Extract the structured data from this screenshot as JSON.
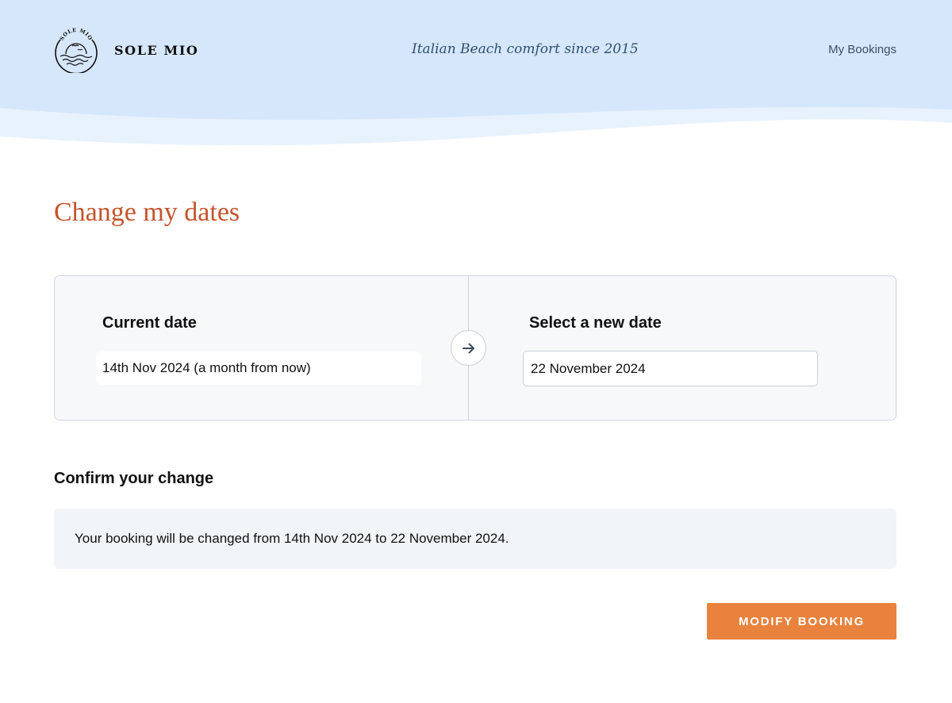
{
  "brand": {
    "name": "SOLE MIO",
    "logo_text": "SOLE MIO",
    "logo_icon": "sun-sea-birds-logo"
  },
  "header": {
    "tagline": "Italian Beach comfort since 2015",
    "nav_link": "My Bookings"
  },
  "page": {
    "title": "Change my dates"
  },
  "date_change": {
    "current_heading": "Current date",
    "current_value": "14th Nov 2024 (a month from now)",
    "arrow_icon": "arrow-right-icon",
    "new_heading": "Select a new date",
    "new_value": "22 November 2024"
  },
  "confirm": {
    "heading": "Confirm your change",
    "message": "Your booking will be changed from 14th Nov 2024 to 22 November 2024."
  },
  "actions": {
    "modify_label": "MODIFY BOOKING"
  },
  "colors": {
    "header_bg": "#d6e7fb",
    "wave_light": "#e8f2fd",
    "title": "#c4542d",
    "button": "#e8823c",
    "card_bg": "#f7f8fa",
    "confirm_bg": "#f1f4f8"
  }
}
